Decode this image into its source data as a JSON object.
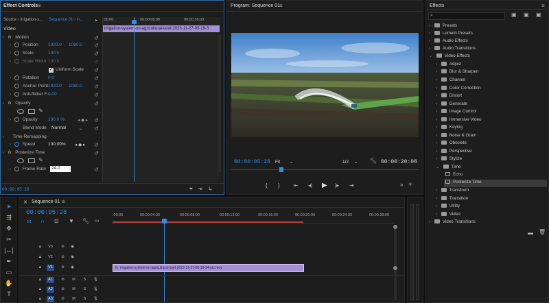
{
  "effect_controls": {
    "title": "Effect Controls",
    "source_label": "Source › irrigation-s...",
    "sequence_label": "Sequence 01 › irr...",
    "ruler_ticks": [
      ":00:00",
      "00:00:08:00",
      "00:00:16:00"
    ],
    "clip_bar": "irrigation-system-on-agricultural-land-2023-11-27-05-19-3",
    "video_label": "Video",
    "motion": "Motion",
    "position_label": "Position",
    "position_x": "1920.0",
    "position_y": "1080.0",
    "scale_label": "Scale",
    "scale_value": "100.0",
    "scale_width_label": "Scale Width",
    "scale_width_value": "100.0",
    "uniform_scale": "Uniform Scale",
    "rotation_label": "Rotation",
    "rotation_value": "0.0",
    "anchor_label": "Anchor Point",
    "anchor_x": "1920.0",
    "anchor_y": "1080.0",
    "antiflicker_label": "Anti-flicker F...",
    "antiflicker_value": "0.00",
    "opacity": "Opacity",
    "opacity_label": "Opacity",
    "opacity_value": "100.0 %",
    "blend_label": "Blend Mode",
    "blend_value": "Normal",
    "time_remap": "Time Remapping",
    "speed_label": "Speed",
    "speed_value": "100.00%",
    "posterize": "Posterize Time",
    "frame_rate_label": "Frame Rate",
    "frame_rate_value": "24.0",
    "timecode": "00:00:05:28"
  },
  "program": {
    "title": "Program: Sequence 01",
    "timecode": "00:00:05:28",
    "fit": "Fit",
    "resolution": "1/2",
    "duration": "00:00:20:08"
  },
  "effects": {
    "title": "Effects",
    "search_placeholder": "",
    "top": [
      "Presets",
      "Lumetri Presets",
      "Audio Effects",
      "Audio Transitions",
      "Video Effects"
    ],
    "video_effects": [
      "Adjust",
      "Blur & Sharpen",
      "Channel",
      "Color Correction",
      "Distort",
      "Generate",
      "Image Control",
      "Immersive Video",
      "Keying",
      "Noise & Grain",
      "Obsolete",
      "Perspective",
      "Stylize",
      "Time"
    ],
    "time_children": [
      "Echo",
      "Posterize Time"
    ],
    "after": [
      "Transform",
      "Transition",
      "Utility",
      "Video"
    ],
    "last": "Video Transitions"
  },
  "timeline": {
    "title": "Sequence 01",
    "timecode": "00:00:05:28",
    "ruler": [
      ":00:00",
      "00:00:04:00",
      "00:00:08:00",
      "00:00:12:00",
      "00:00:16:00",
      "00:00:20:00",
      "00:00:24:00",
      "00:00:28:00"
    ],
    "tracks": [
      "V3",
      "V2",
      "V1",
      "A1",
      "A2",
      "A3"
    ],
    "clip": "irrigation-system-on-agricultural-land-2023-11-27-05-19-34-utc.mov"
  },
  "colors": {
    "accent": "#2f8de4",
    "clip": "#a58fd6",
    "playhead": "#2f8de4"
  }
}
